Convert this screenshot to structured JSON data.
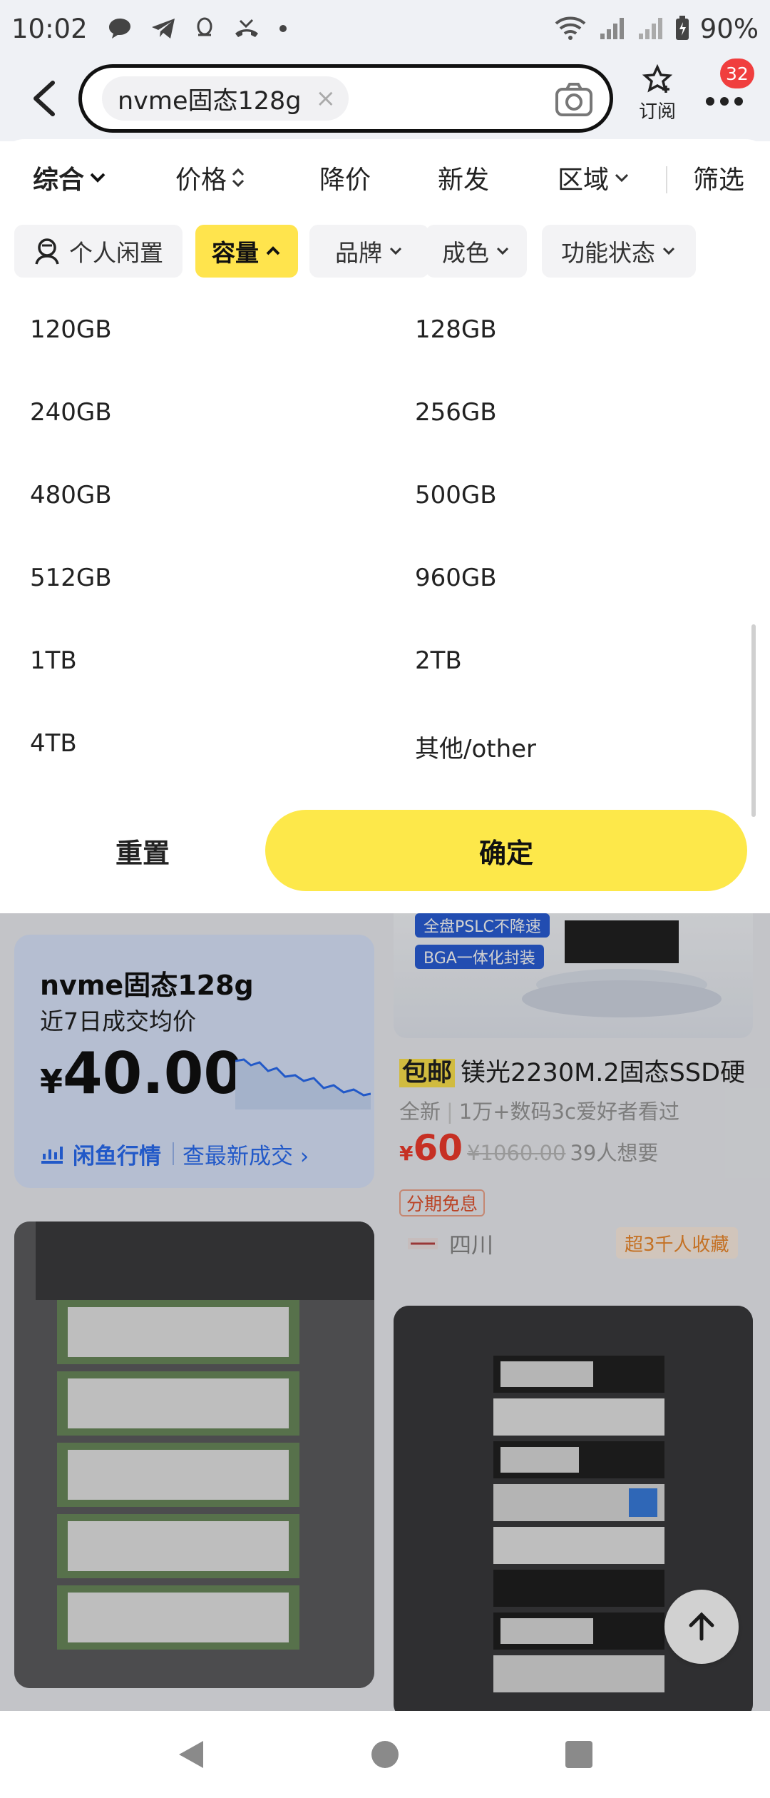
{
  "status_bar": {
    "time": "10:02",
    "battery": "90%",
    "left_icons": [
      "chat-bubble-icon",
      "telegram-icon",
      "qq-icon",
      "missed-call-icon",
      "dot-icon"
    ],
    "right_icons": [
      "wifi-icon",
      "signal-icon",
      "signal-icon",
      "battery-icon"
    ]
  },
  "search": {
    "query": "nvme固态128g",
    "clear": "×"
  },
  "header": {
    "subscribe_label": "订阅",
    "message_count": "32"
  },
  "sort_bar": {
    "items": [
      {
        "label": "综合"
      },
      {
        "label": "价格"
      },
      {
        "label": "降价"
      },
      {
        "label": "新发"
      },
      {
        "label": "区域"
      },
      {
        "label": "筛选"
      }
    ]
  },
  "filters": {
    "items": [
      {
        "label": "个人闲置"
      },
      {
        "label": "容量",
        "active": true
      },
      {
        "label": "品牌"
      },
      {
        "label": "成色"
      },
      {
        "label": "功能状态"
      }
    ]
  },
  "capacity_options": [
    "120GB",
    "128GB",
    "240GB",
    "256GB",
    "480GB",
    "500GB",
    "512GB",
    "960GB",
    "1TB",
    "2TB",
    "4TB",
    "其他/other"
  ],
  "actions": {
    "reset": "重置",
    "confirm": "确定"
  },
  "price_card": {
    "title": "nvme固态128g",
    "subtitle": "近7日成交均价",
    "currency": "¥",
    "price": "40.00",
    "brand": "闲鱼行情",
    "link": "查最新成交"
  },
  "product": {
    "tags": [
      "全盘PSLC不降速",
      "BGA一体化封装"
    ],
    "badge": "包邮",
    "title": "镁光2230M.2固态SSD硬",
    "condition": "全新",
    "views": "1万+数码3c爱好者看过",
    "currency": "¥",
    "price": "60",
    "original_price": "¥1060.00",
    "wants": "39人想要",
    "installment": "分期免息",
    "location": "四川",
    "hot_label": "超3千人收藏"
  },
  "colors": {
    "accent_yellow": "#fde84a",
    "price_red": "#f23b2c",
    "brand_blue": "#2a6df4"
  }
}
